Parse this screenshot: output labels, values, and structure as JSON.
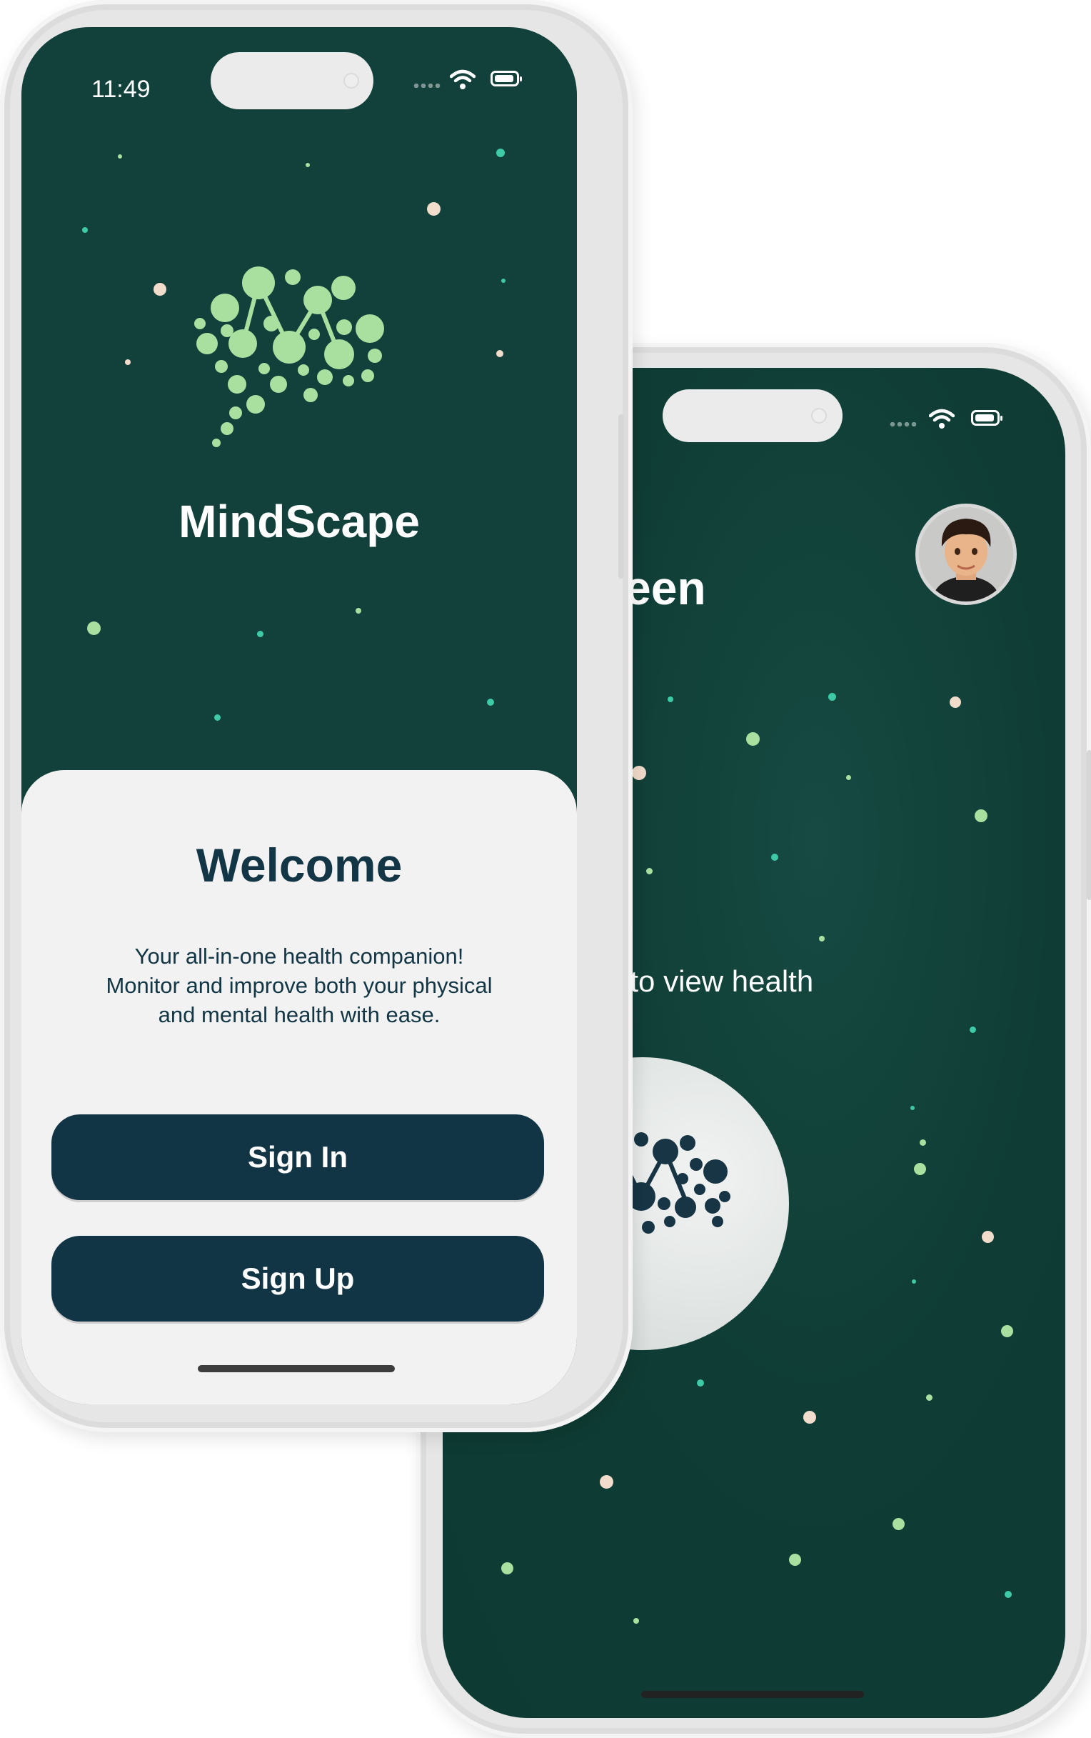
{
  "colors": {
    "screen_bg": "#12403a",
    "sheet_bg": "#f2f2f2",
    "button_bg": "#123545",
    "text_dark": "#123645",
    "logo_green": "#a9e0a0",
    "logo_dark": "#173545"
  },
  "front_phone": {
    "status_bar": {
      "time": "11:49",
      "icons": [
        "signal-dots-icon",
        "wifi-icon",
        "battery-icon"
      ]
    },
    "logo_icon": "brain-network-logo-icon",
    "app_name": "MindScape",
    "welcome_title": "Welcome",
    "description_lines": [
      "Your all-in-one health companion!",
      "Monitor and improve both your physical",
      "and mental health with ease."
    ],
    "sign_in_label": "Sign In",
    "sign_up_label": "Sign Up"
  },
  "back_phone": {
    "status_bar": {
      "icons": [
        "signal-dots-icon",
        "wifi-icon",
        "battery-icon"
      ]
    },
    "greeting_partial": "Green",
    "avatar_icon": "user-avatar",
    "tap_prompt_partial": "Tap to view health",
    "health_button_icon": "brain-network-logo-icon"
  }
}
